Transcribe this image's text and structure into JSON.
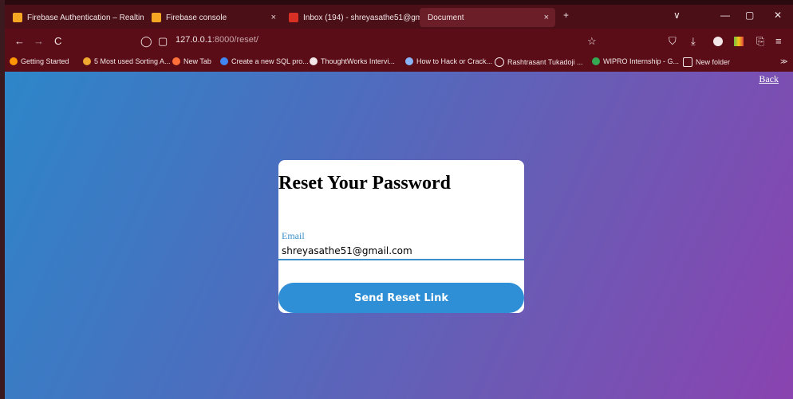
{
  "tabs": [
    {
      "title": "Firebase Authentication – Realtim",
      "close": "×",
      "icon": "firebase-icon",
      "color": "#f5a623"
    },
    {
      "title": "Firebase console",
      "close": "×",
      "icon": "firebase-icon",
      "color": "#f5a623"
    },
    {
      "title": "Inbox (194) - shreyasathe51@gm",
      "close": "×",
      "icon": "gmail-icon",
      "color": "#d93025"
    },
    {
      "title": "Document",
      "close": "×",
      "icon": "",
      "color": ""
    }
  ],
  "toolbar": {
    "new_tab": "+",
    "url_host": "127.0.0.1",
    "url_path": ":8000/reset/",
    "back": "←",
    "forward": "→",
    "reload": "C",
    "shield": "◯",
    "page": "▢",
    "star": "☆",
    "pocket": "⛉",
    "download": "⤓",
    "minimize": "—",
    "restore": "▢",
    "close": "✕",
    "chevron": "∨",
    "more": "≫"
  },
  "bookmarks": [
    "Getting Started",
    "5 Most used Sorting A...",
    "New Tab",
    "Create a new SQL pro...",
    "ThoughtWorks Intervi...",
    "How to Hack or Crack...",
    "Rashtrasant Tukadoji ...",
    "WIPRO Internship - G...",
    "New folder"
  ],
  "page": {
    "back_link": "Back",
    "heading": "Reset Your Password",
    "email_label": "Email",
    "email_value": "shreyasathe51@gmail.com",
    "submit_label": "Send Reset Link"
  },
  "colors": {
    "accent": "#2e8fd6",
    "gradient_start": "#2d86c9",
    "gradient_end": "#8a43b0",
    "chrome": "#5a0d16"
  }
}
